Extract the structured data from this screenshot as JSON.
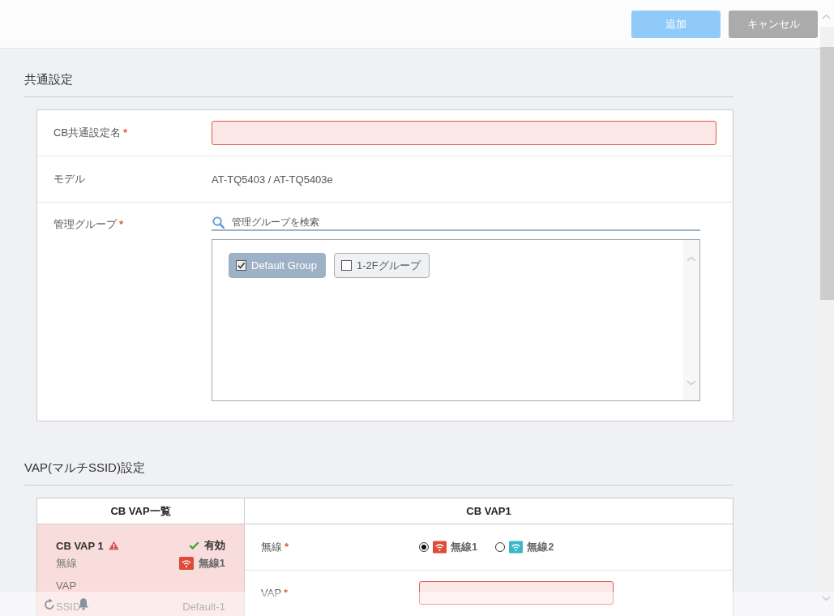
{
  "toolbar": {
    "buttons": [
      {
        "label": "追加",
        "kind": "primary",
        "disabled": true
      },
      {
        "label": "キャンセル",
        "kind": "secondary",
        "disabled": false
      }
    ]
  },
  "common_settings": {
    "title": "共通設定",
    "rows": [
      {
        "kind": "input",
        "label": "CB共通設定名",
        "required_mark": "*",
        "invalid": true
      },
      {
        "kind": "text",
        "label": "モデル",
        "value": "AT-TQ5403 / AT-TQ5403e"
      },
      {
        "kind": "groups",
        "label": "管理グループ",
        "required_mark": "*",
        "search": {
          "placeholder": "管理グループを検索"
        },
        "groups": [
          {
            "label": "Default Group",
            "checked": true
          },
          {
            "label": "1-2Fグループ",
            "checked": false
          }
        ]
      }
    ]
  },
  "vap_settings": {
    "title": "VAP(マルチSSID)設定",
    "list": {
      "heading": "CB VAP一覧",
      "items": [
        {
          "name": "CB VAP 1",
          "selected": true,
          "warning": true,
          "status": "有効",
          "enabled": true,
          "fields": [
            {
              "label": "無線",
              "value": "無線1",
              "color": "#dd4b39"
            },
            {
              "label": "VAP"
            },
            {
              "label": "SSID",
              "value": "Default-1"
            }
          ]
        }
      ]
    },
    "detail": {
      "heading": "CB VAP1",
      "rows": [
        {
          "kind": "radio",
          "label": "無線",
          "required_mark": "*",
          "options": [
            {
              "label": "無線1",
              "selected": true,
              "color": "#dd4b39"
            },
            {
              "label": "無線2",
              "selected": false,
              "color": "#3bb8c8"
            }
          ]
        },
        {
          "kind": "input",
          "label": "VAP",
          "required_mark": "*",
          "invalid": true
        }
      ]
    }
  }
}
